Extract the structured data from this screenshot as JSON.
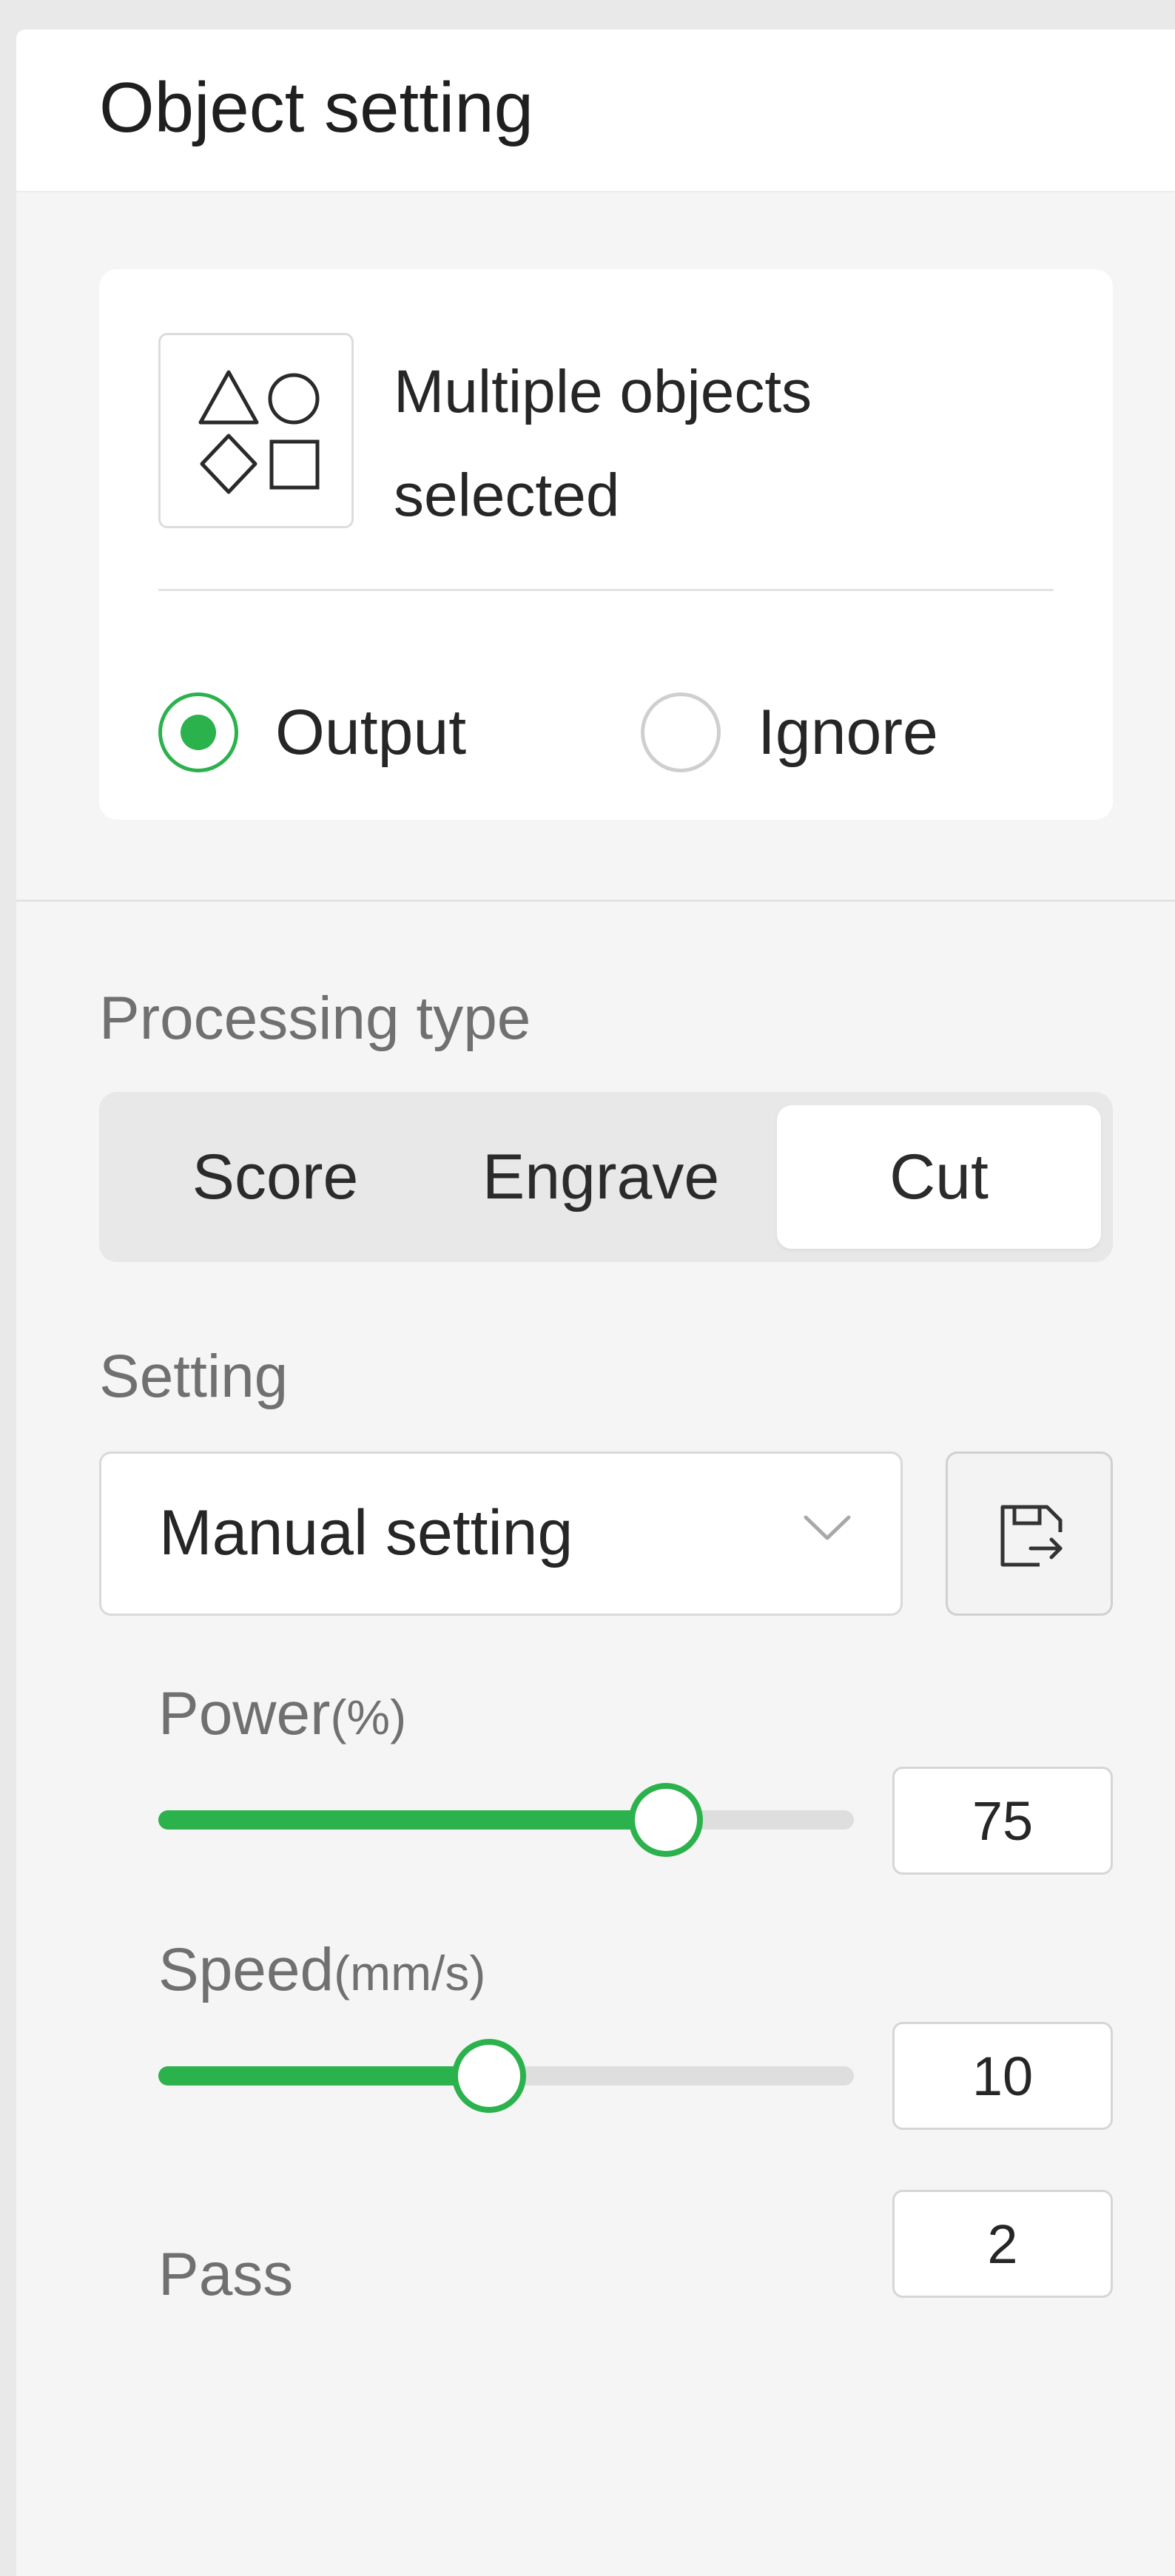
{
  "panel": {
    "title": "Object setting"
  },
  "object_card": {
    "selection_icon": "shapes-icon",
    "selection_text": "Multiple objects selected",
    "output_options": [
      {
        "label": "Output",
        "checked": true
      },
      {
        "label": "Ignore",
        "checked": false
      }
    ]
  },
  "processing": {
    "label": "Processing type",
    "types": [
      "Score",
      "Engrave",
      "Cut"
    ],
    "active": "Cut"
  },
  "setting": {
    "label": "Setting",
    "preset_value": "Manual setting",
    "chevron_icon": "chevron-down-icon",
    "save_icon": "save-preset-icon"
  },
  "params": {
    "power": {
      "label": "Power",
      "unit": "(%)",
      "value": "75",
      "fraction": 0.73
    },
    "speed": {
      "label": "Speed",
      "unit": "(mm/s)",
      "value": "10",
      "fraction": 0.475
    },
    "pass": {
      "label": "Pass",
      "value": "2"
    }
  },
  "colors": {
    "accent": "#2bb24c",
    "panel_bg": "#f5f5f5",
    "card_bg": "#ffffff"
  }
}
